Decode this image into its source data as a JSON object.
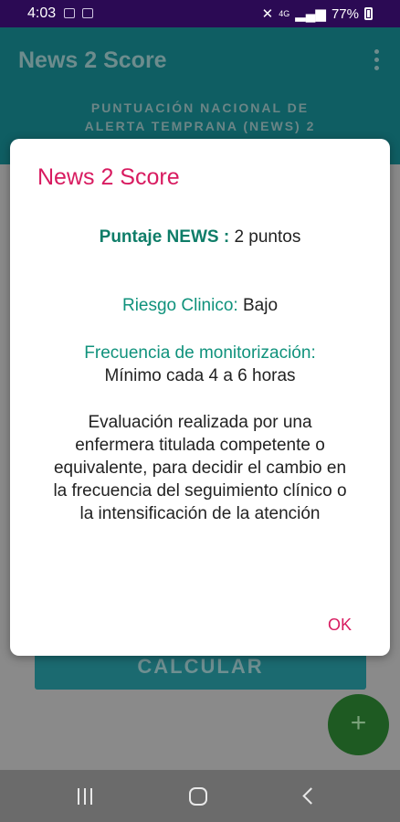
{
  "status_bar": {
    "time": "4:03",
    "network": "4G",
    "battery": "77%"
  },
  "app_bar": {
    "title": "News 2 Score",
    "subtitle_line1": "PUNTUACIÓN NACIONAL DE",
    "subtitle_line2": "ALERTA TEMPRANA (NEWS) 2"
  },
  "background": {
    "calc_button": "CALCULAR",
    "fab_label": "+"
  },
  "dialog": {
    "title": "News 2 Score",
    "score_label": "Puntaje NEWS :",
    "score_value": " 2 puntos",
    "risk_label": "Riesgo Clinico:",
    "risk_value": " Bajo",
    "freq_label": "Frecuencia de monitorización:",
    "freq_value": "Mínimo cada 4 a 6 horas",
    "description": "Evaluación realizada por una enfermera titulada competente o equivalente, para decidir el cambio en la frecuencia del seguimiento clínico o la intensificación de la atención",
    "ok_label": "OK"
  }
}
